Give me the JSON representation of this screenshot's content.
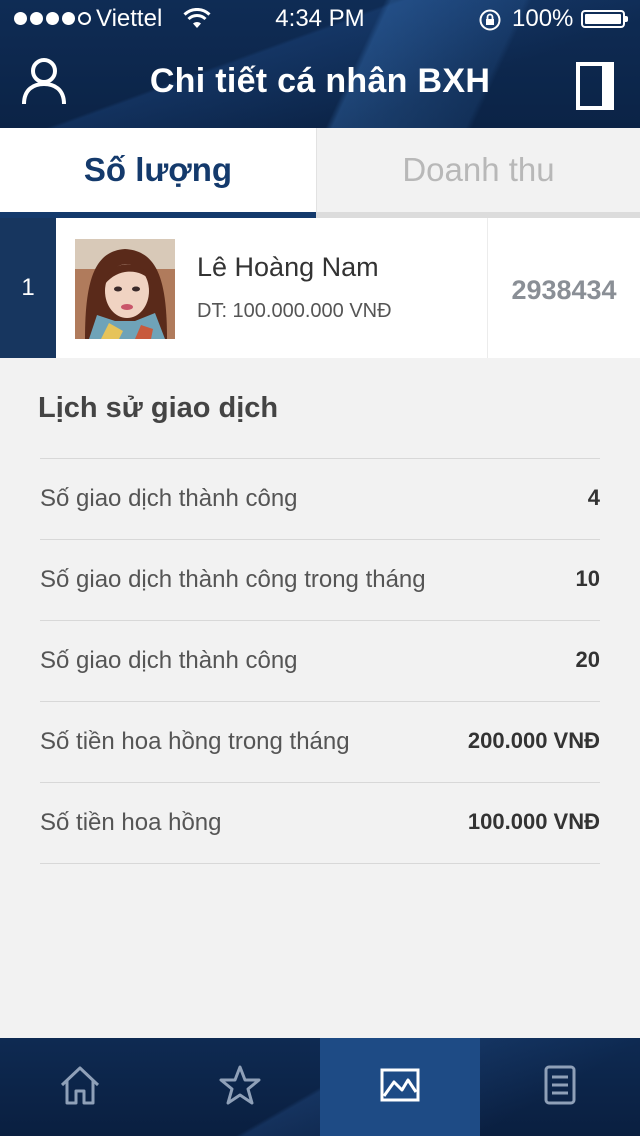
{
  "status_bar": {
    "carrier": "Viettel",
    "time": "4:34 PM",
    "battery": "100%"
  },
  "nav": {
    "title": "Chi tiết cá nhân BXH",
    "left_icon": "user-icon",
    "right_icon": "document-icon"
  },
  "tabs": [
    {
      "label": "Số lượng",
      "active": true
    },
    {
      "label": "Doanh thu",
      "active": false
    }
  ],
  "ranking": {
    "rank": "1",
    "name": "Lê Hoàng Nam",
    "subtitle": "DT: 100.000.000 VNĐ",
    "score": "2938434"
  },
  "history": {
    "title": "Lịch sử giao dịch",
    "rows": [
      {
        "label": "Số giao dịch thành công",
        "value": "4"
      },
      {
        "label": "Số giao dịch thành công trong tháng",
        "value": "10"
      },
      {
        "label": "Số giao dịch thành công",
        "value": "20"
      },
      {
        "label": "Số tiền hoa hồng trong tháng",
        "value": "200.000 VNĐ"
      },
      {
        "label": "Số tiền hoa hồng",
        "value": "100.000 VNĐ"
      }
    ]
  },
  "bottom_tabs": [
    {
      "icon": "home-icon",
      "active": false
    },
    {
      "icon": "star-icon",
      "active": false
    },
    {
      "icon": "chart-icon",
      "active": true
    },
    {
      "icon": "document-icon",
      "active": false
    }
  ],
  "colors": {
    "primary": "#143a6c",
    "header_bg": "#0f2c55",
    "active_tab_bg": "#1e4b85"
  }
}
